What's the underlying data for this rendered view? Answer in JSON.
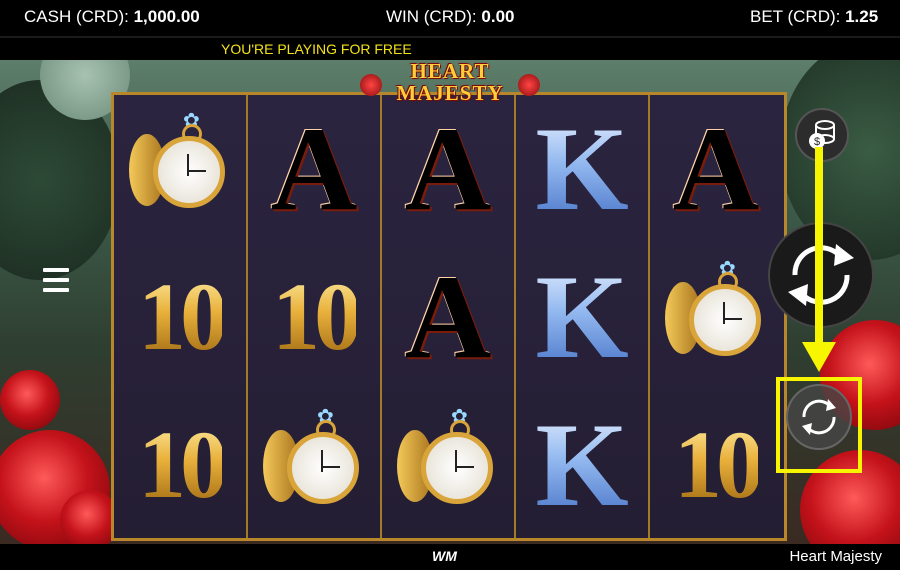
{
  "header": {
    "cash_label": "CASH (CRD):",
    "cash_value": "1,000.00",
    "win_label": "WIN (CRD):",
    "win_value": "0.00",
    "bet_label": "BET (CRD):",
    "bet_value": "1.25"
  },
  "notice": "YOU'RE PLAYING FOR FREE",
  "logo": {
    "line1": "HEART",
    "line2": "MAJESTY"
  },
  "reels": [
    [
      "watch",
      "10",
      "10"
    ],
    [
      "A",
      "10",
      "watch"
    ],
    [
      "A",
      "A",
      "watch"
    ],
    [
      "K",
      "K",
      "K"
    ],
    [
      "A",
      "watch",
      "10"
    ]
  ],
  "icons": {
    "menu": "hamburger-menu-icon",
    "coins": "coin-stack-icon",
    "spin": "spin-arrows-icon",
    "autoplay": "autoplay-cycle-icon"
  },
  "footer": {
    "brand": "WM",
    "game_name": "Heart Majesty"
  },
  "colors": {
    "highlight": "#f7f500",
    "notice_text": "#f3e21a",
    "frame": "#b8862b"
  }
}
